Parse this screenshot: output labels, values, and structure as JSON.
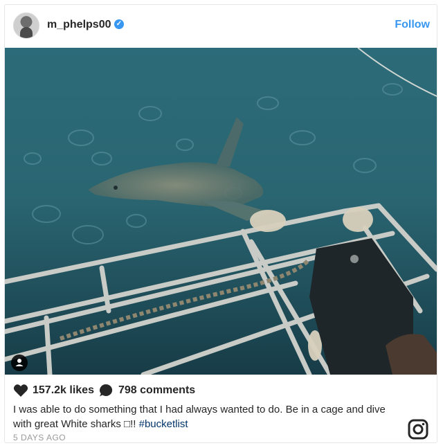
{
  "post": {
    "username": "m_phelps00",
    "follow_label": "Follow",
    "likes": "157.2k likes",
    "comments": "798 comments",
    "caption_text": "I was able to do something that I had always wanted to do. Be in a cage and dive with great White sharks □!! ",
    "hashtag": "#bucketlist",
    "date": "5 DAYS AGO"
  },
  "icons": {
    "verified": "verified-badge-icon",
    "tag": "user-tag-icon",
    "like": "heart-icon",
    "comment": "comment-icon",
    "brand": "instagram-icon"
  },
  "colors": {
    "link": "#3897f0",
    "text": "#262626",
    "muted": "#999999",
    "hashtag": "#003569"
  }
}
